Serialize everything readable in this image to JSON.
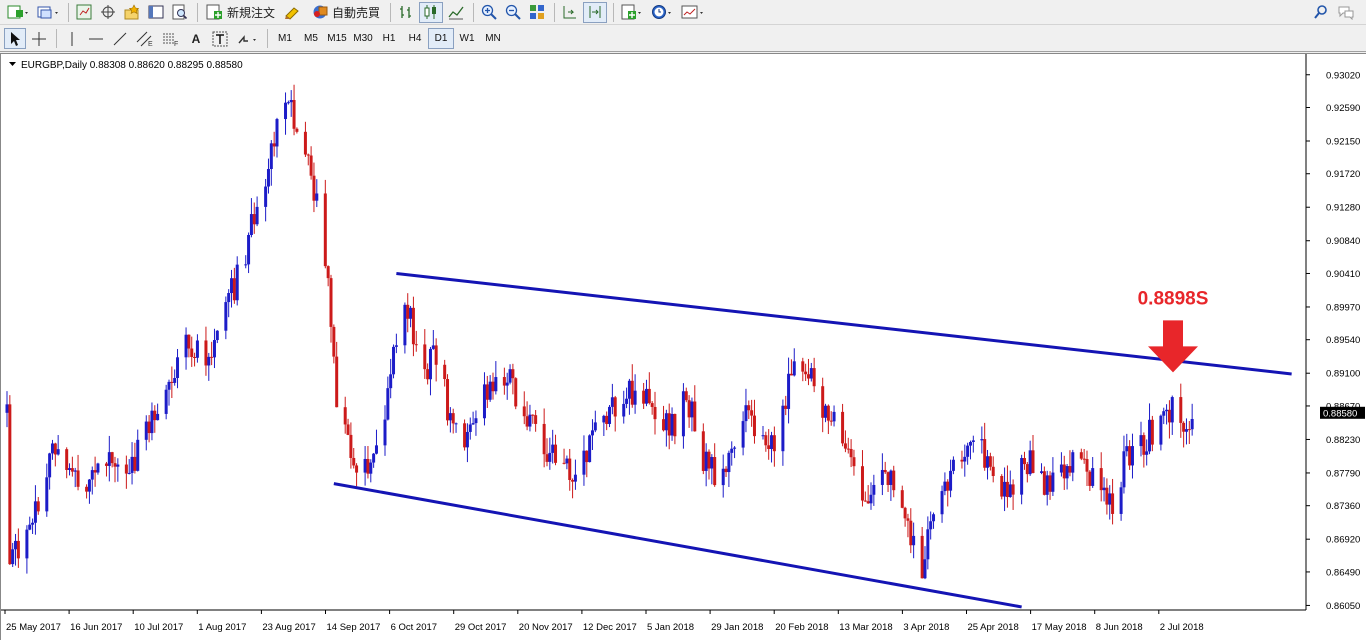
{
  "toolbar": {
    "new_order_label": "新規注文",
    "autotrade_label": "自動売買"
  },
  "timeframes": [
    "M1",
    "M5",
    "M15",
    "M30",
    "H1",
    "H4",
    "D1",
    "W1",
    "MN"
  ],
  "active_timeframe": "D1",
  "chart_header": "EURGBP,Daily  0.88308 0.88620 0.88295 0.88580",
  "annotation": {
    "label": "0.8898S",
    "color": "#e8262a"
  },
  "colors": {
    "bull": "#1c1cc8",
    "bear": "#cc1a1a",
    "channel": "#1414b4"
  },
  "chart_data": {
    "type": "candlestick",
    "symbol": "EURGBP",
    "period": "Daily",
    "last_price": 0.8858,
    "y_ticks": [
      0.9302,
      0.9259,
      0.9215,
      0.9172,
      0.9128,
      0.9084,
      0.9041,
      0.8997,
      0.8954,
      0.891,
      0.8867,
      0.8823,
      0.8779,
      0.8736,
      0.8692,
      0.8649,
      0.8605
    ],
    "ylim": [
      0.8599,
      0.9324
    ],
    "x_labels": [
      "25 May 2017",
      "16 Jun 2017",
      "10 Jul 2017",
      "1 Aug 2017",
      "23 Aug 2017",
      "14 Sep 2017",
      "6 Oct 2017",
      "29 Oct 2017",
      "20 Nov 2017",
      "12 Dec 2017",
      "5 Jan 2018",
      "29 Jan 2018",
      "20 Feb 2018",
      "13 Mar 2018",
      "3 Apr 2018",
      "25 Apr 2018",
      "17 May 2018",
      "8 Jun 2018",
      "2 Jul 2018"
    ],
    "close_path": [
      [
        "2017-05-23",
        0.865
      ],
      [
        "2017-06-01",
        0.8735
      ],
      [
        "2017-06-08",
        0.881
      ],
      [
        "2017-06-16",
        0.8755
      ],
      [
        "2017-06-26",
        0.879
      ],
      [
        "2017-07-05",
        0.879
      ],
      [
        "2017-07-10",
        0.884
      ],
      [
        "2017-07-17",
        0.889
      ],
      [
        "2017-07-24",
        0.894
      ],
      [
        "2017-08-01",
        0.893
      ],
      [
        "2017-08-08",
        0.901
      ],
      [
        "2017-08-14",
        0.906
      ],
      [
        "2017-08-18",
        0.914
      ],
      [
        "2017-08-23",
        0.92
      ],
      [
        "2017-08-28",
        0.9265
      ],
      [
        "2017-08-31",
        0.925
      ],
      [
        "2017-09-05",
        0.92
      ],
      [
        "2017-09-08",
        0.913
      ],
      [
        "2017-09-12",
        0.902
      ],
      [
        "2017-09-15",
        0.886
      ],
      [
        "2017-09-20",
        0.881
      ],
      [
        "2017-09-26",
        0.877
      ],
      [
        "2017-10-02",
        0.884
      ],
      [
        "2017-10-06",
        0.896
      ],
      [
        "2017-10-10",
        0.899
      ],
      [
        "2017-10-16",
        0.892
      ],
      [
        "2017-10-20",
        0.893
      ],
      [
        "2017-10-25",
        0.885
      ],
      [
        "2017-10-29",
        0.88
      ],
      [
        "2017-11-03",
        0.885
      ],
      [
        "2017-11-08",
        0.89
      ],
      [
        "2017-11-14",
        0.891
      ],
      [
        "2017-11-20",
        0.886
      ],
      [
        "2017-11-24",
        0.884
      ],
      [
        "2017-11-30",
        0.88
      ],
      [
        "2017-12-06",
        0.878
      ],
      [
        "2017-12-12",
        0.881
      ],
      [
        "2017-12-18",
        0.885
      ],
      [
        "2017-12-26",
        0.888
      ],
      [
        "2018-01-02",
        0.889
      ],
      [
        "2018-01-05",
        0.887
      ],
      [
        "2018-01-10",
        0.883
      ],
      [
        "2018-01-16",
        0.888
      ],
      [
        "2018-01-22",
        0.88
      ],
      [
        "2018-01-29",
        0.877
      ],
      [
        "2018-02-05",
        0.885
      ],
      [
        "2018-02-12",
        0.884
      ],
      [
        "2018-02-16",
        0.88
      ],
      [
        "2018-02-20",
        0.888
      ],
      [
        "2018-02-26",
        0.893
      ],
      [
        "2018-03-02",
        0.889
      ],
      [
        "2018-03-08",
        0.885
      ],
      [
        "2018-03-13",
        0.88
      ],
      [
        "2018-03-20",
        0.8745
      ],
      [
        "2018-03-28",
        0.877
      ],
      [
        "2018-04-03",
        0.872
      ],
      [
        "2018-04-09",
        0.866
      ],
      [
        "2018-04-13",
        0.872
      ],
      [
        "2018-04-18",
        0.876
      ],
      [
        "2018-04-25",
        0.882
      ],
      [
        "2018-05-01",
        0.88
      ],
      [
        "2018-05-08",
        0.876
      ],
      [
        "2018-05-17",
        0.879
      ],
      [
        "2018-05-25",
        0.876
      ],
      [
        "2018-06-01",
        0.879
      ],
      [
        "2018-06-08",
        0.878
      ],
      [
        "2018-06-15",
        0.874
      ],
      [
        "2018-06-20",
        0.88
      ],
      [
        "2018-06-26",
        0.882
      ],
      [
        "2018-07-02",
        0.885
      ],
      [
        "2018-07-06",
        0.887
      ],
      [
        "2018-07-10",
        0.884
      ],
      [
        "2018-07-13",
        0.8858
      ]
    ],
    "channel_upper": [
      [
        "2017-10-06",
        0.9041
      ],
      [
        "2018-08-17",
        0.8909
      ]
    ],
    "channel_lower": [
      [
        "2017-09-14",
        0.8765
      ],
      [
        "2018-05-14",
        0.8603
      ]
    ],
    "annotation_level": 0.8898
  }
}
